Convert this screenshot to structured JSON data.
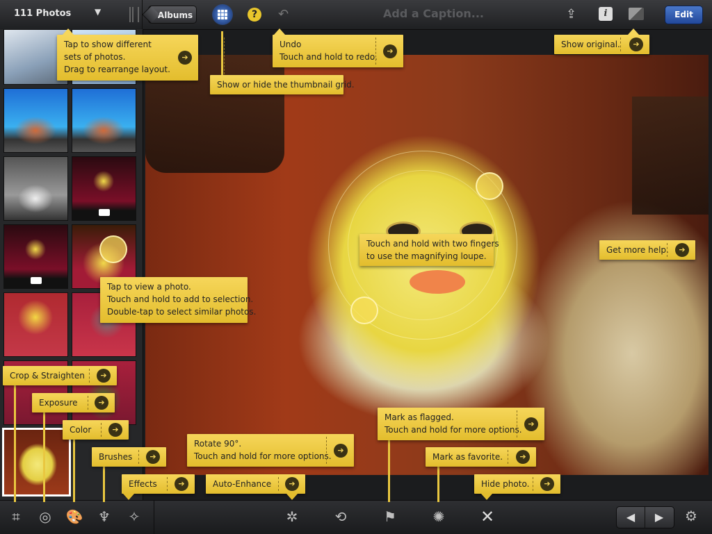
{
  "top_bar": {
    "photos_count": "111 Photos",
    "albums_label": "Albums",
    "help_label": "?",
    "caption_placeholder": "Add a Caption...",
    "edit_label": "Edit",
    "info_label": "i"
  },
  "callouts": {
    "change_view": [
      "Tap to show different",
      "sets of photos.",
      "Drag to rearrange layout."
    ],
    "thumb_grid": [
      "Show or hide the thumbnail grid."
    ],
    "undo": [
      "Undo",
      "Touch and hold to redo."
    ],
    "show_original": [
      "Show original."
    ],
    "loupe": [
      "Touch and hold with two fingers",
      "to use the magnifying loupe."
    ],
    "get_help": [
      "Get more help."
    ],
    "view_photo": [
      "Tap to view a photo.",
      "Touch and hold to add to selection.",
      "Double-tap to select similar photos."
    ],
    "crop": [
      "Crop & Straighten"
    ],
    "exposure": [
      "Exposure"
    ],
    "color": [
      "Color"
    ],
    "brushes": [
      "Brushes"
    ],
    "effects": [
      "Effects"
    ],
    "rotate": [
      "Rotate 90°.",
      "Touch and hold for more options."
    ],
    "auto_enhance": [
      "Auto-Enhance"
    ],
    "flag": [
      "Mark as flagged.",
      "Touch and hold for more options."
    ],
    "favorite": [
      "Mark as favorite."
    ],
    "hide": [
      "Hide photo."
    ]
  },
  "bottom_bar": {
    "icons": [
      "crop-icon",
      "exposure-icon",
      "color-palette-icon",
      "brushes-icon",
      "effects-icon",
      "auto-enhance-icon",
      "rotate-icon",
      "flag-icon",
      "favorite-icon",
      "hide-icon",
      "previous-arrow-icon",
      "next-arrow-icon",
      "settings-gear-icon"
    ]
  },
  "colors": {
    "callout": "#f0cc4a",
    "callout_button": "#3a3214",
    "edit_button": "#2f5bb0",
    "toolbar": "#26272a"
  }
}
